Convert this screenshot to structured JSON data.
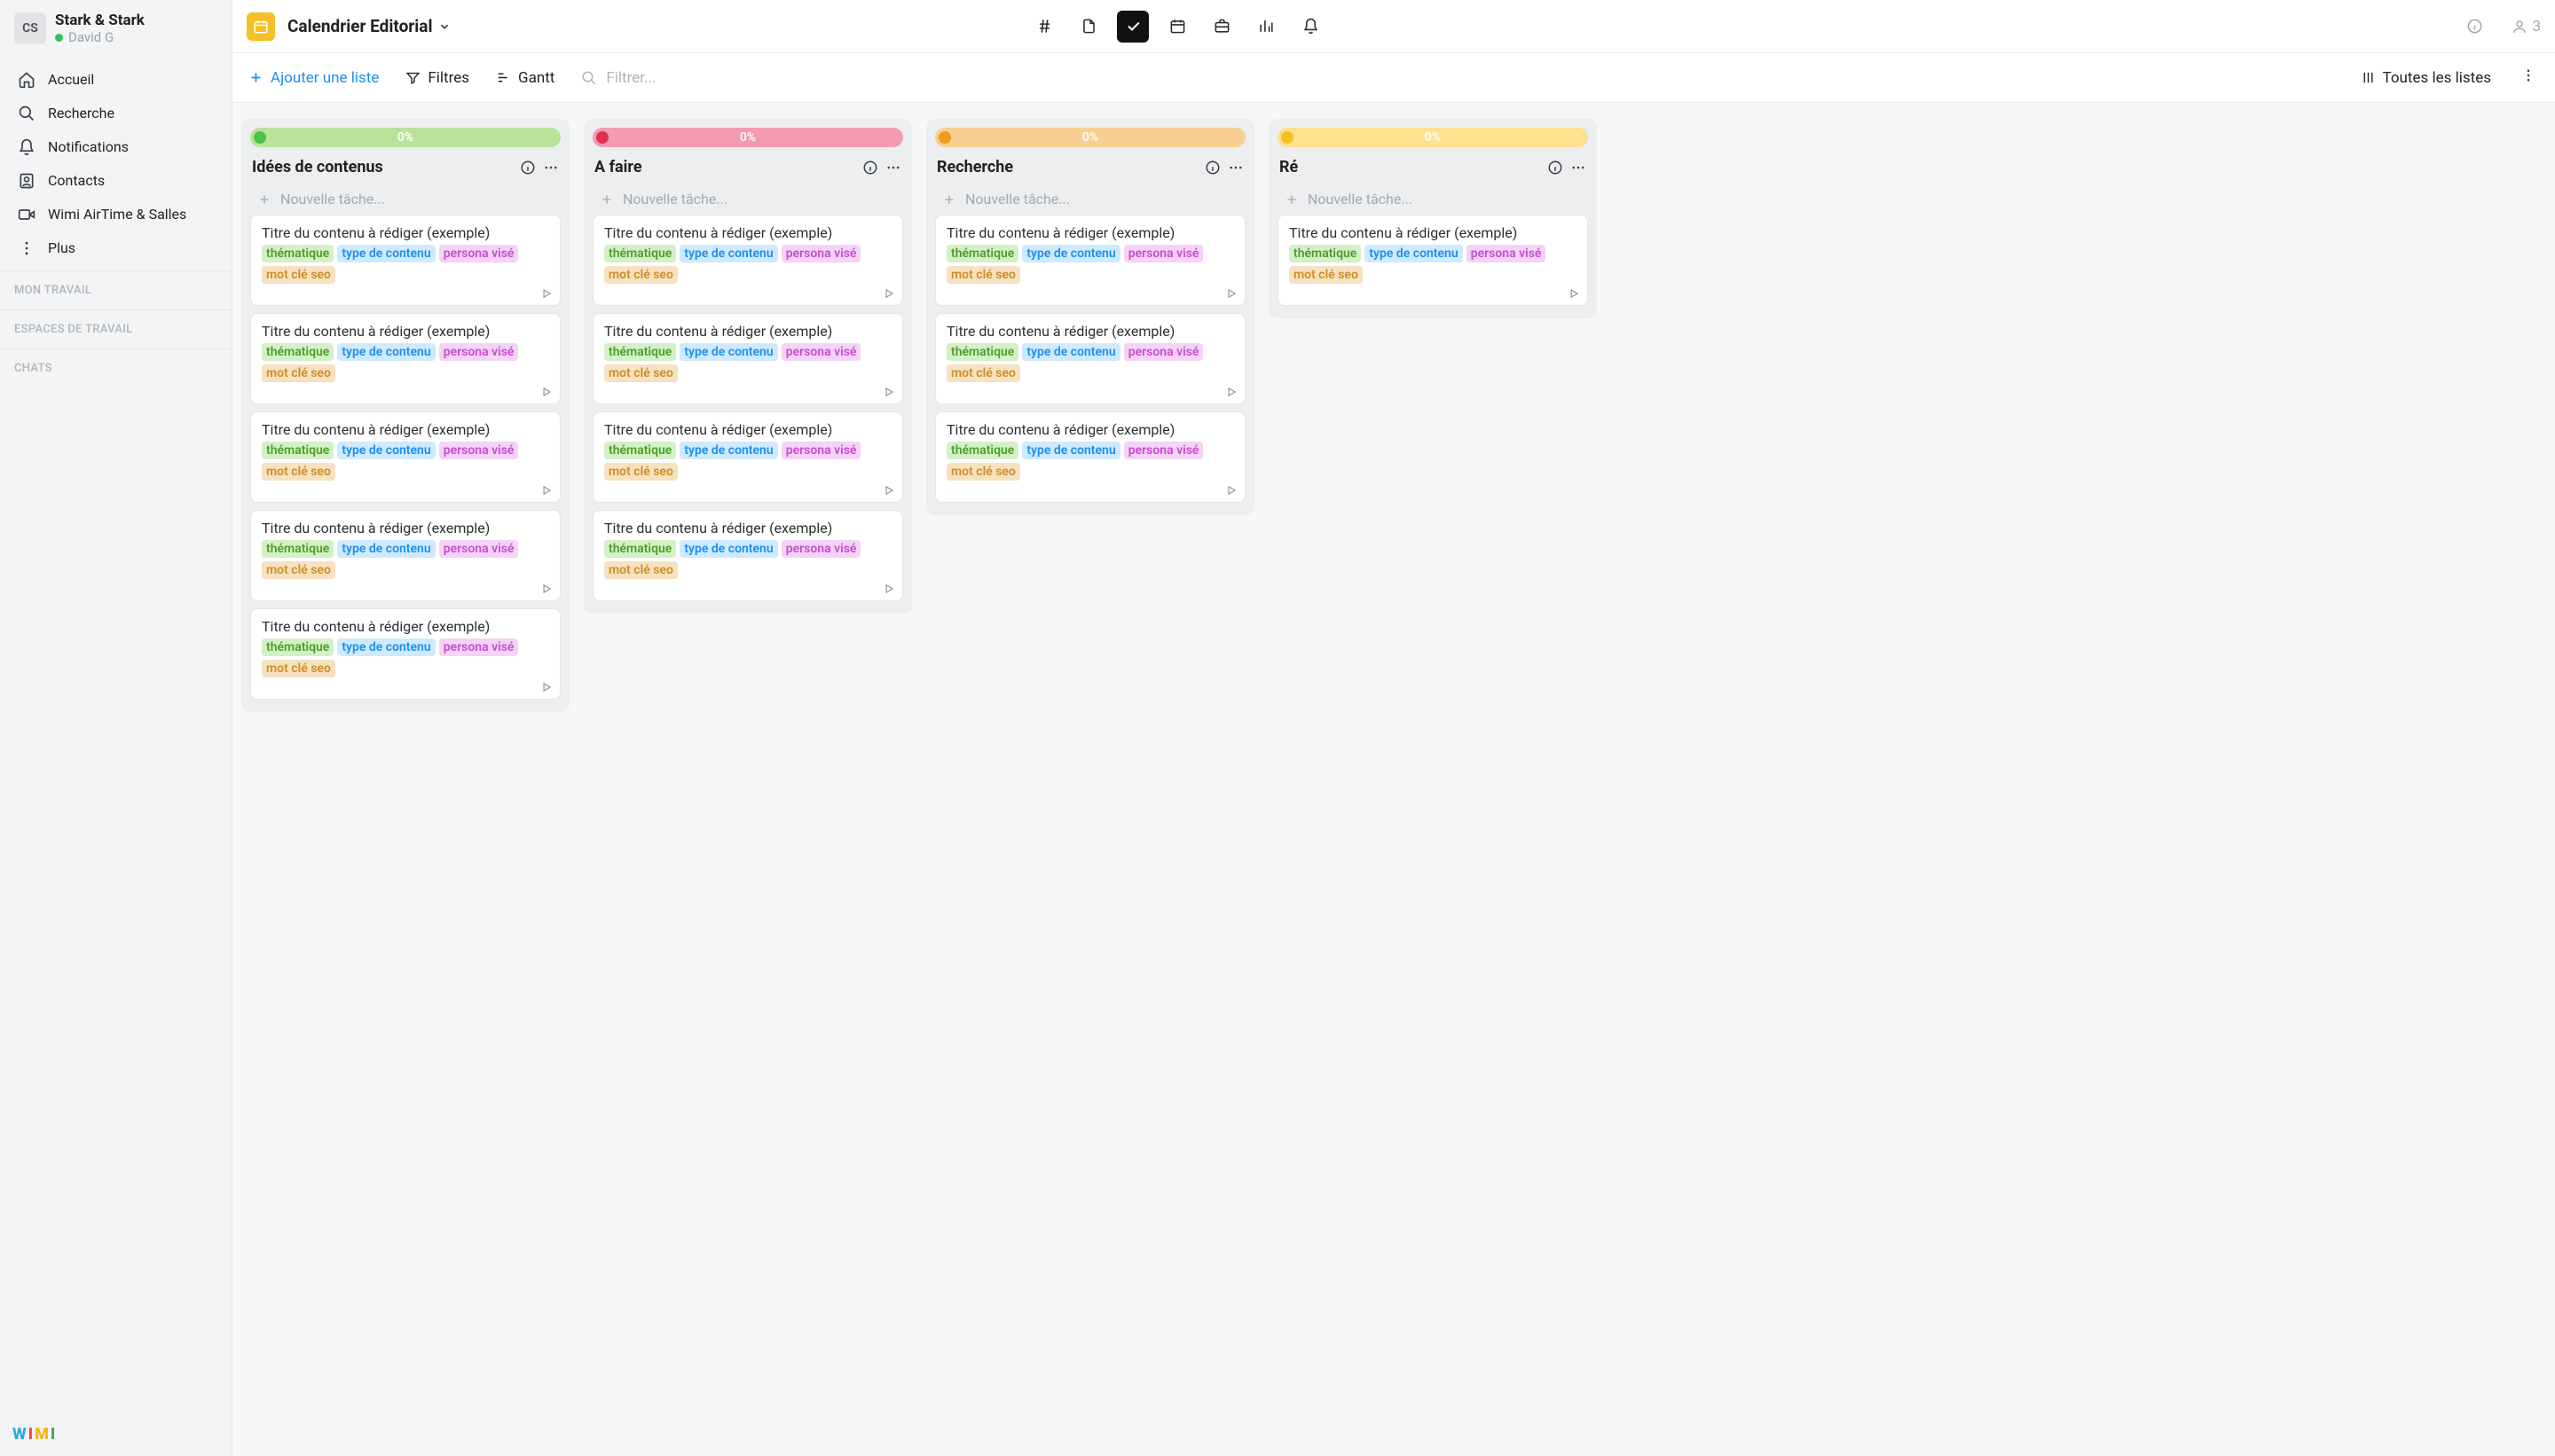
{
  "org": {
    "initials": "CS",
    "name": "Stark & Stark",
    "user": "David G"
  },
  "nav": {
    "home": "Accueil",
    "search": "Recherche",
    "notifications": "Notifications",
    "contacts": "Contacts",
    "airtime": "Wimi AirTime & Salles",
    "more": "Plus"
  },
  "sections": {
    "my_work": "MON TRAVAIL",
    "workspaces": "ESPACES DE TRAVAIL",
    "chats": "CHATS"
  },
  "logo": {
    "w": "W",
    "i1": "I",
    "m": "M",
    "i2": "I"
  },
  "header": {
    "project": "Calendrier Editorial",
    "user_count": "3"
  },
  "toolbar": {
    "add_list": "Ajouter une liste",
    "filters": "Filtres",
    "gantt": "Gantt",
    "filter_placeholder": "Filtrer...",
    "all_lists": "Toutes les listes"
  },
  "list_common": {
    "new_task": "Nouvelle tâche...",
    "card_title": "Titre du contenu à rédiger (exemple)",
    "tag_theme": "thématique",
    "tag_type": "type de contenu",
    "tag_persona": "persona visé",
    "tag_seo": "mot clé seo"
  },
  "columns": [
    {
      "title": "Idées de contenus",
      "percent": "0%",
      "bar": "#b9e29a",
      "dot": "#4dc24b",
      "count": 5
    },
    {
      "title": "A faire",
      "percent": "0%",
      "bar": "#f39bb1",
      "dot": "#e0304e",
      "count": 4
    },
    {
      "title": "Recherche",
      "percent": "0%",
      "bar": "#f7cf92",
      "dot": "#ef9a1f",
      "count": 3
    },
    {
      "title": "Ré",
      "percent": "0%",
      "bar": "#ffe08f",
      "dot": "#f4c025",
      "count": 1
    }
  ]
}
